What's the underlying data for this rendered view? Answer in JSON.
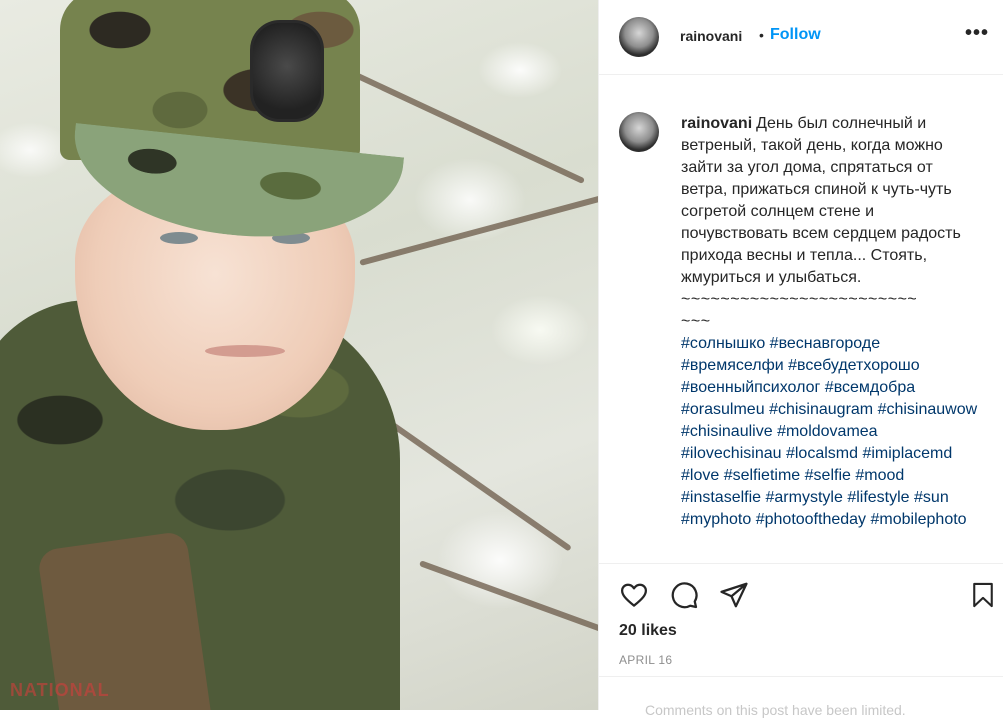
{
  "post": {
    "username": "rainovani",
    "follow_label": "Follow",
    "dot": "•",
    "more_label": "•••",
    "caption_text": "День был солнечный и ветреный, такой день, когда можно зайти за угол дома, спрятаться от ветра, прижаться спиной к чуть-чуть согретой солнцем стене и почувствовать всем сердцем радость прихода весны и тепла... Стоять, жмуриться и улыбаться.",
    "tilde_line_1": "~~~~~~~~~~~~~~~~~~~~~~~~",
    "tilde_line_2": "~~~",
    "hashtags": [
      "#солнышко",
      "#веснавгороде",
      "#времяселфи",
      "#всебудетхорошо",
      "#военныйпсихолог",
      "#всемдобра",
      "#orasulmeu",
      "#chisinaugram",
      "#chisinauwow",
      "#chisinaulive",
      "#moldovamea",
      "#ilovechisinau",
      "#localsmd",
      "#imiplacemd",
      "#love",
      "#selfietime",
      "#selfie",
      "#mood",
      "#instaselfie",
      "#armystyle",
      "#lifestyle",
      "#sun",
      "#myphoto",
      "#photooftheday",
      "#mobilephoto"
    ],
    "likes": "20 likes",
    "date": "APRIL 16",
    "comments_notice": "Comments on this post have been limited."
  },
  "photo": {
    "watermark": "NATIONAL"
  },
  "icons": {
    "like": "heart-icon",
    "comment": "comment-icon",
    "share": "share-icon",
    "save": "bookmark-icon"
  },
  "colors": {
    "follow": "#0095f6",
    "hashtag": "#00376b",
    "muted": "#8e8e8e"
  }
}
